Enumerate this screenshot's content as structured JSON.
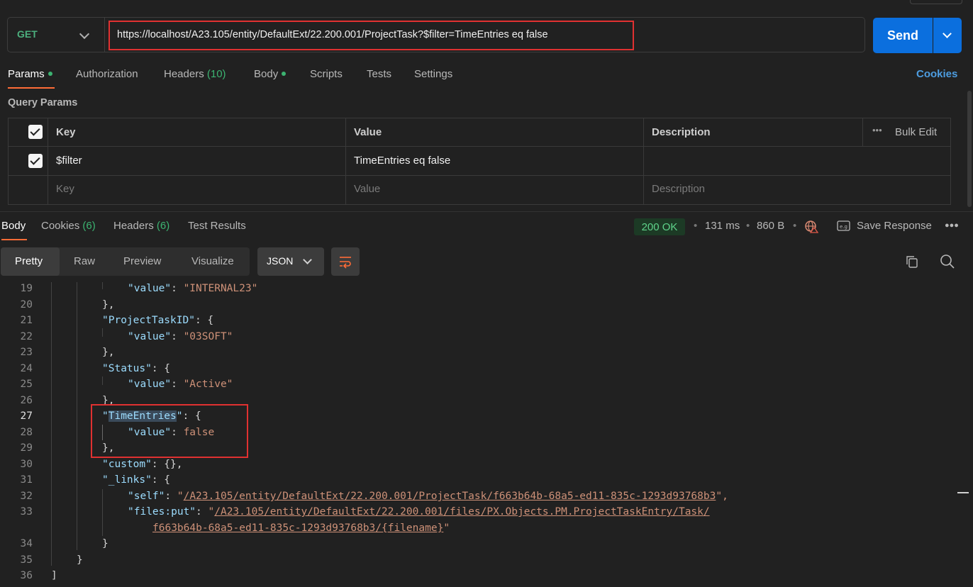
{
  "request": {
    "method": "GET",
    "url": "https://localhost/A23.105/entity/DefaultExt/22.200.001/ProjectTask?$filter=TimeEntries eq false",
    "send_label": "Send"
  },
  "request_tabs": {
    "params": "Params",
    "authorization": "Authorization",
    "headers": "Headers",
    "headers_count": "(10)",
    "body": "Body",
    "scripts": "Scripts",
    "tests": "Tests",
    "settings": "Settings",
    "cookies": "Cookies"
  },
  "query_params": {
    "title": "Query Params",
    "columns": {
      "key": "Key",
      "value": "Value",
      "description": "Description",
      "bulk_edit": "Bulk Edit"
    },
    "rows": [
      {
        "key": "$filter",
        "value": "TimeEntries eq false",
        "description": "",
        "enabled": true
      }
    ],
    "placeholders": {
      "key": "Key",
      "value": "Value",
      "description": "Description"
    }
  },
  "response_tabs": {
    "body": "Body",
    "cookies": "Cookies",
    "cookies_count": "(6)",
    "headers": "Headers",
    "headers_count": "(6)",
    "test_results": "Test Results"
  },
  "response_status": {
    "status": "200 OK",
    "time": "131 ms",
    "size": "860 B",
    "save_response": "Save Response"
  },
  "view_modes": {
    "pretty": "Pretty",
    "raw": "Raw",
    "preview": "Preview",
    "visualize": "Visualize",
    "format": "JSON"
  },
  "code": {
    "line_numbers": [
      "19",
      "20",
      "21",
      "22",
      "23",
      "24",
      "25",
      "26",
      "27",
      "28",
      "29",
      "30",
      "31",
      "32",
      "33",
      "",
      "34",
      "35",
      "36"
    ],
    "lines": {
      "l19_key": "\"value\"",
      "l19_val": "\"INTERNAL23\"",
      "l20": "},",
      "l21_key": "\"ProjectTaskID\"",
      "l21_rest": ": {",
      "l22_key": "\"value\"",
      "l22_val": "\"03SOFT\"",
      "l23": "},",
      "l24_key": "\"Status\"",
      "l24_rest": ": {",
      "l25_key": "\"value\"",
      "l25_val": "\"Active\"",
      "l26": "},",
      "l27_q1": "\"",
      "l27_word": "TimeEntries",
      "l27_q2": "\"",
      "l27_rest": ": {",
      "l28_key": "\"value\"",
      "l28_val": "false",
      "l29": "},",
      "l30_key": "\"custom\"",
      "l30_rest": ": {},",
      "l31_key": "\"_links\"",
      "l31_rest": ": {",
      "l32_key": "\"self\"",
      "l32_q1": "\"",
      "l32_val": "/A23.105/entity/DefaultExt/22.200.001/ProjectTask/f663b64b-68a5-ed11-835c-1293d93768b3",
      "l32_q2": "\",",
      "l33_key": "\"files:put\"",
      "l33_q1": "\"",
      "l33_val": "/A23.105/entity/DefaultExt/22.200.001/files/PX.Objects.PM.ProjectTaskEntry/Task/",
      "l33b_val": "f663b64b-68a5-ed11-835c-1293d93768b3/{filename}",
      "l33b_q2": "\"",
      "l34": "}",
      "l35": "}",
      "l36": "]"
    }
  },
  "colors": {
    "accent": "#ff6c37",
    "send": "#0b6fde",
    "ok": "#5fd38a",
    "highlight": "#e03131"
  }
}
